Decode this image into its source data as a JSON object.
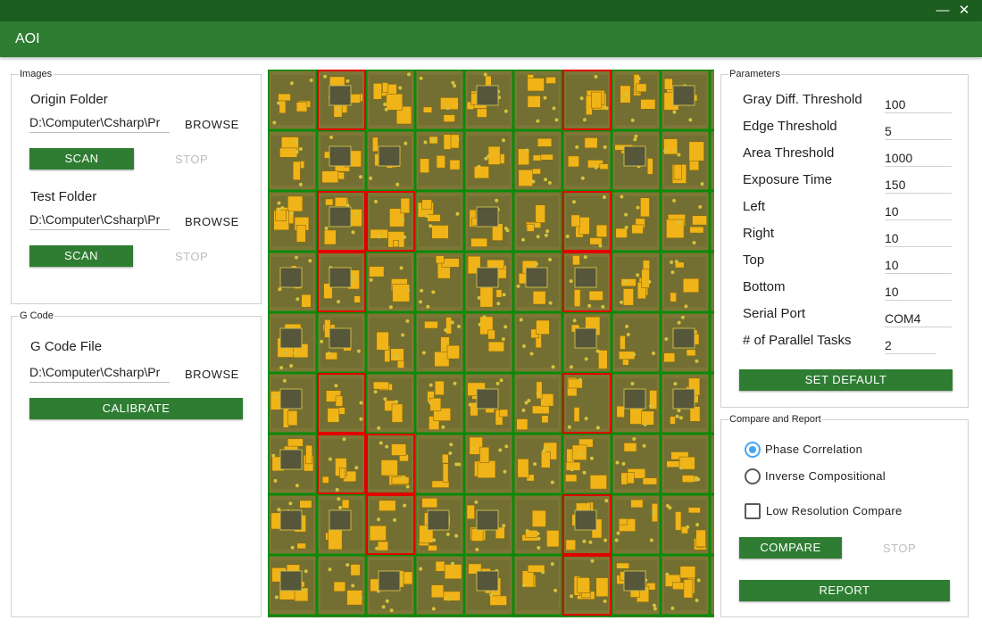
{
  "window": {
    "title": "AOI",
    "minimize_glyph": "—",
    "close_glyph": "✕"
  },
  "images_group": {
    "legend": "Images",
    "origin_label": "Origin Folder",
    "origin_path": "D:\\Computer\\Csharp\\Pr",
    "browse_label": "BROWSE",
    "scan_label": "SCAN",
    "stop_label": "STOP",
    "test_label": "Test Folder",
    "test_path": "D:\\Computer\\Csharp\\Pr"
  },
  "gcode_group": {
    "legend": "G Code",
    "file_label": "G Code File",
    "file_path": "D:\\Computer\\Csharp\\Pr",
    "browse_label": "BROWSE",
    "calibrate_label": "CALIBRATE"
  },
  "parameters": {
    "legend": "Parameters",
    "rows": [
      {
        "label": "Gray Diff. Threshold",
        "value": "100"
      },
      {
        "label": "Edge Threshold",
        "value": "5"
      },
      {
        "label": "Area Threshold",
        "value": "1000"
      },
      {
        "label": "Exposure Time",
        "value": "150"
      },
      {
        "label": "Left",
        "value": "10"
      },
      {
        "label": "Right",
        "value": "10"
      },
      {
        "label": "Top",
        "value": "10"
      },
      {
        "label": "Bottom",
        "value": "10"
      },
      {
        "label": "Serial Port",
        "value": "COM4"
      },
      {
        "label": "# of Parallel Tasks",
        "value": "2"
      }
    ],
    "default_label": "SET DEFAULT"
  },
  "compare": {
    "legend": "Compare and Report",
    "phase_label": "Phase Correlation",
    "phase_selected": true,
    "inverse_label": "Inverse Compositional",
    "inverse_selected": false,
    "lowres_label": "Low Resolution Compare",
    "lowres_checked": false,
    "compare_label": "COMPARE",
    "stop_label": "STOP",
    "report_label": "REPORT"
  },
  "viewer": {
    "grid_rows": 9,
    "grid_cols": 9,
    "ok_color": "#0a8a0a",
    "defect_color": "#e00000",
    "board_color": "#7d7636",
    "pad_color": "#f0b418",
    "defect_cells": [
      [
        0,
        1
      ],
      [
        0,
        6
      ],
      [
        2,
        1
      ],
      [
        2,
        2
      ],
      [
        2,
        6
      ],
      [
        3,
        1
      ],
      [
        3,
        6
      ],
      [
        5,
        1
      ],
      [
        5,
        6
      ],
      [
        6,
        1
      ],
      [
        6,
        2
      ],
      [
        7,
        2
      ],
      [
        7,
        6
      ],
      [
        8,
        6
      ]
    ]
  }
}
